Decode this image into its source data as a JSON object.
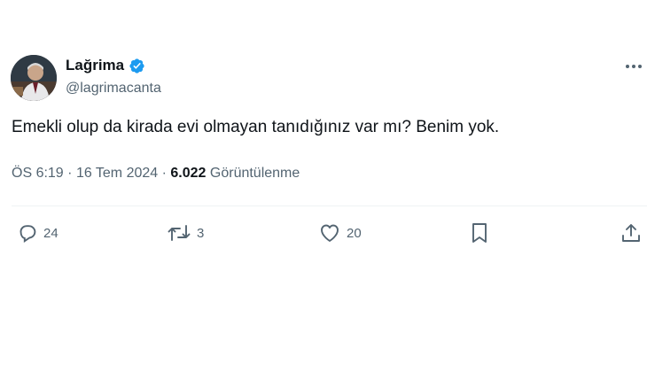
{
  "author": {
    "display_name": "Lağrima",
    "handle": "@lagrimacanta",
    "verified": true,
    "avatar": "profile-photo"
  },
  "tweet": {
    "text": "Emekli olup da kirada evi olmayan tanıdığınız var mı? Benim yok.",
    "time": "ÖS 6:19",
    "date": "16 Tem 2024",
    "views_count": "6.022",
    "views_label": "Görüntülenme",
    "separator": "·"
  },
  "actions": {
    "replies": "24",
    "retweets": "3",
    "likes": "20"
  },
  "icons": {
    "more": "more-horizontal-icon",
    "reply": "reply-bubble-icon",
    "retweet": "retweet-icon",
    "like": "heart-icon",
    "bookmark": "bookmark-icon",
    "share": "share-upload-icon"
  },
  "colors": {
    "text": "#0f1419",
    "secondary": "#536471",
    "verified": "#1d9bf0",
    "divider": "#eff3f4"
  }
}
